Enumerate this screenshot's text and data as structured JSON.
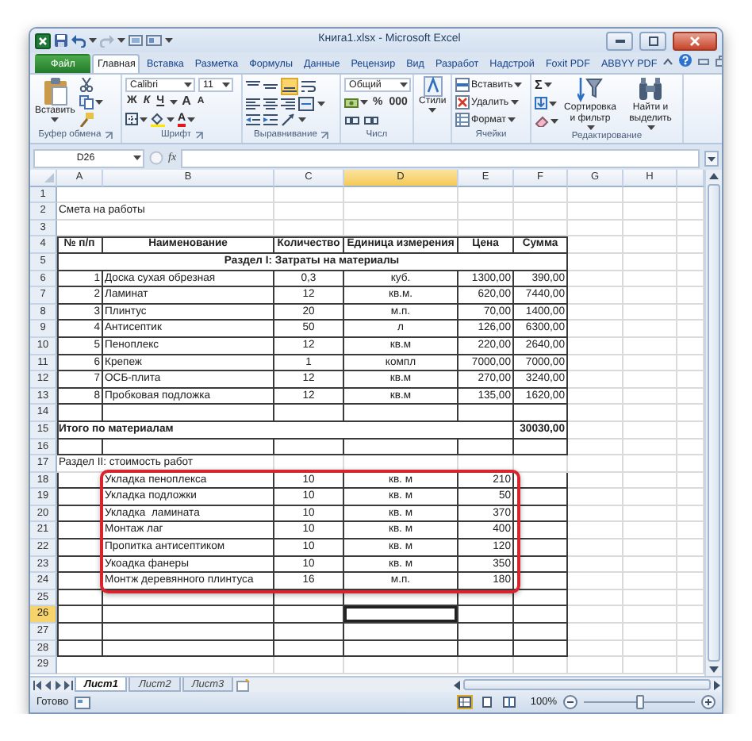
{
  "window": {
    "title": "Книга1.xlsx - Microsoft Excel"
  },
  "ribbon_tabs": [
    {
      "label": "Файл",
      "kind": "file",
      "selected": false
    },
    {
      "label": "Главная",
      "kind": "tab",
      "selected": true
    },
    {
      "label": "Вставка",
      "kind": "tab",
      "selected": false
    },
    {
      "label": "Разметка",
      "kind": "tab",
      "selected": false
    },
    {
      "label": "Формулы",
      "kind": "tab",
      "selected": false
    },
    {
      "label": "Данные",
      "kind": "tab",
      "selected": false
    },
    {
      "label": "Рецензир",
      "kind": "tab",
      "selected": false
    },
    {
      "label": "Вид",
      "kind": "tab",
      "selected": false
    },
    {
      "label": "Разработ",
      "kind": "tab",
      "selected": false
    },
    {
      "label": "Надстрой",
      "kind": "tab",
      "selected": false
    },
    {
      "label": "Foxit PDF",
      "kind": "tab",
      "selected": false
    },
    {
      "label": "ABBYY PDF",
      "kind": "tab",
      "selected": false
    }
  ],
  "ribbon_groups": [
    {
      "kind": "clipboard",
      "label": "Буфер обмена",
      "paste": "Вставить"
    },
    {
      "kind": "font",
      "label": "Шрифт",
      "font_name": "Calibri",
      "font_size": "11",
      "bold": "Ж",
      "italic": "К",
      "underline": "Ч",
      "grow": "A",
      "shrink": "A",
      "font_color": "A"
    },
    {
      "kind": "alignment",
      "label": "Выравнивание"
    },
    {
      "kind": "number",
      "label": "Числ",
      "format": "Общий",
      "percent": "%",
      "thousands": "000"
    },
    {
      "kind": "styles",
      "button": "Стили"
    },
    {
      "kind": "cells",
      "label": "Ячейки",
      "buttons": [
        "Вставить",
        "Удалить",
        "Формат"
      ]
    },
    {
      "kind": "editing",
      "label": "Редактирование",
      "sum": "Σ",
      "sort": "Сортировка и фильтр",
      "find": "Найти и выделить"
    }
  ],
  "formula_bar": {
    "name_box": "D26",
    "fx": "fx"
  },
  "columns": [
    {
      "label": "A",
      "selected": false
    },
    {
      "label": "B",
      "selected": false
    },
    {
      "label": "C",
      "selected": false
    },
    {
      "label": "D",
      "selected": true
    },
    {
      "label": "E",
      "selected": false
    },
    {
      "label": "F",
      "selected": false
    },
    {
      "label": "G",
      "selected": false
    },
    {
      "label": "H",
      "selected": false
    }
  ],
  "rows": [
    {
      "number": "1",
      "kind": "plain",
      "selected": false,
      "highlighted": false,
      "cells": []
    },
    {
      "number": "2",
      "kind": "plain",
      "selected": false,
      "highlighted": false,
      "cells": [
        "Смета на работы"
      ]
    },
    {
      "number": "3",
      "kind": "plain",
      "selected": false,
      "highlighted": false,
      "cells": []
    },
    {
      "number": "4",
      "kind": "header",
      "selected": false,
      "highlighted": false,
      "cells": [
        "№ п/п",
        "Наименование",
        "Количество",
        "Единица измерения",
        "Цена",
        "Сумма"
      ]
    },
    {
      "number": "5",
      "kind": "section",
      "selected": false,
      "highlighted": false,
      "cells": [
        "Раздел I: Затраты на материалы"
      ]
    },
    {
      "number": "6",
      "kind": "item",
      "selected": false,
      "highlighted": false,
      "cells": [
        "1",
        "Доска сухая обрезная",
        "0,3",
        "куб.",
        "1300,00",
        "390,00"
      ]
    },
    {
      "number": "7",
      "kind": "item",
      "selected": false,
      "highlighted": false,
      "cells": [
        "2",
        "Ламинат",
        "12",
        "кв.м.",
        "620,00",
        "7440,00"
      ]
    },
    {
      "number": "8",
      "kind": "item",
      "selected": false,
      "highlighted": false,
      "cells": [
        "3",
        "Плинтус",
        "20",
        "м.п.",
        "70,00",
        "1400,00"
      ]
    },
    {
      "number": "9",
      "kind": "item",
      "selected": false,
      "highlighted": false,
      "cells": [
        "4",
        "Антисептик",
        "50",
        "л",
        "126,00",
        "6300,00"
      ]
    },
    {
      "number": "10",
      "kind": "item",
      "selected": false,
      "highlighted": false,
      "cells": [
        "5",
        "Пеноплекс",
        "12",
        "кв.м",
        "220,00",
        "2640,00"
      ]
    },
    {
      "number": "11",
      "kind": "item",
      "selected": false,
      "highlighted": false,
      "cells": [
        "6",
        "Крепеж",
        "1",
        "компл",
        "7000,00",
        "7000,00"
      ]
    },
    {
      "number": "12",
      "kind": "item",
      "selected": false,
      "highlighted": false,
      "cells": [
        "7",
        "ОСБ-плита",
        "12",
        "кв.м",
        "270,00",
        "3240,00"
      ]
    },
    {
      "number": "13",
      "kind": "item",
      "selected": false,
      "highlighted": false,
      "cells": [
        "8",
        "Пробковая подложка",
        "12",
        "кв.м",
        "135,00",
        "1620,00"
      ]
    },
    {
      "number": "14",
      "kind": "grid",
      "selected": false,
      "highlighted": false,
      "cells": []
    },
    {
      "number": "15",
      "kind": "total",
      "selected": false,
      "highlighted": false,
      "cells": [
        "Итого по материалам",
        null,
        null,
        null,
        null,
        "30030,00"
      ]
    },
    {
      "number": "16",
      "kind": "grid",
      "selected": false,
      "highlighted": false,
      "cells": []
    },
    {
      "number": "17",
      "kind": "plain",
      "selected": false,
      "highlighted": false,
      "cells": [
        "Раздел II: стоимость работ"
      ]
    },
    {
      "number": "18",
      "kind": "work",
      "selected": false,
      "highlighted": true,
      "cells": [
        null,
        "Укладка пеноплекса",
        "10",
        "кв. м",
        "210"
      ]
    },
    {
      "number": "19",
      "kind": "work",
      "selected": false,
      "highlighted": true,
      "cells": [
        null,
        "Укладка подложки",
        "10",
        "кв. м",
        "50"
      ]
    },
    {
      "number": "20",
      "kind": "work",
      "selected": false,
      "highlighted": true,
      "cells": [
        null,
        "Укладка  ламината",
        "10",
        "кв. м",
        "370"
      ]
    },
    {
      "number": "21",
      "kind": "work",
      "selected": false,
      "highlighted": true,
      "cells": [
        null,
        "Монтаж лаг",
        "10",
        "кв. м",
        "400"
      ]
    },
    {
      "number": "22",
      "kind": "work",
      "selected": false,
      "highlighted": true,
      "cells": [
        null,
        "Пропитка антисептиком",
        "10",
        "кв. м",
        "120"
      ]
    },
    {
      "number": "23",
      "kind": "work",
      "selected": false,
      "highlighted": true,
      "cells": [
        null,
        "Укоадка фанеры",
        "10",
        "кв. м",
        "350"
      ]
    },
    {
      "number": "24",
      "kind": "work",
      "selected": false,
      "highlighted": true,
      "cells": [
        null,
        "Монтж деревянного плинтуса",
        "16",
        "м.п.",
        "180"
      ]
    },
    {
      "number": "25",
      "kind": "grid",
      "selected": false,
      "highlighted": false,
      "cells": []
    },
    {
      "number": "26",
      "kind": "grid",
      "selected": true,
      "highlighted": false,
      "cells": []
    },
    {
      "number": "27",
      "kind": "grid",
      "selected": false,
      "highlighted": false,
      "cells": []
    },
    {
      "number": "28",
      "kind": "grid",
      "selected": false,
      "highlighted": false,
      "cells": []
    },
    {
      "number": "29",
      "kind": "plain",
      "selected": false,
      "highlighted": false,
      "cells": []
    }
  ],
  "sheet_tabs": [
    {
      "label": "Лист1",
      "selected": true
    },
    {
      "label": "Лист2",
      "selected": false
    },
    {
      "label": "Лист3",
      "selected": false
    }
  ],
  "status_bar": {
    "status": "Готово",
    "views": [
      {
        "kind": "normal",
        "selected": true
      },
      {
        "kind": "layout",
        "selected": false
      },
      {
        "kind": "pagebreak",
        "selected": false
      }
    ],
    "zoom": "100%",
    "zoom_slider": {
      "level": 0.5
    }
  }
}
